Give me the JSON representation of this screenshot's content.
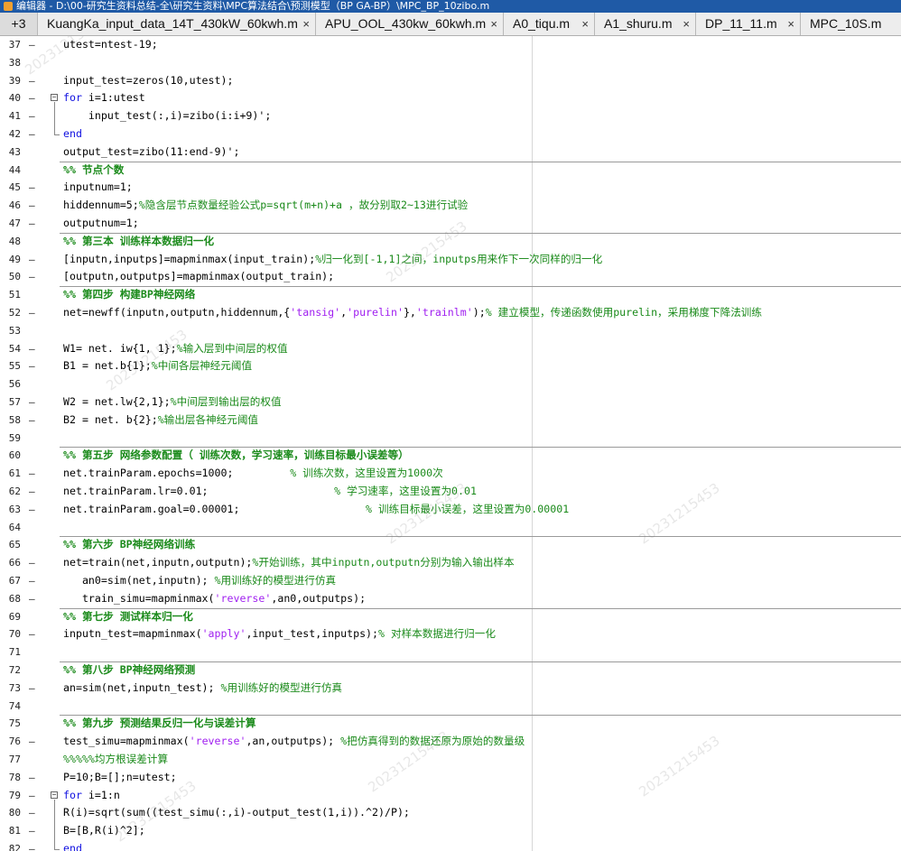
{
  "window": {
    "title": "编辑器 - D:\\00-研究生资料总结-全\\研究生资料\\MPC算法结合\\预测模型（BP GA-BP）\\MPC_BP_10zibo.m"
  },
  "tabs": {
    "overflow_count": "+3",
    "items": [
      {
        "label": "KuangKa_input_data_14T_430kW_60kwh.m",
        "close": "×"
      },
      {
        "label": "APU_OOL_430kw_60kwh.m",
        "close": "×"
      },
      {
        "label": "A0_tiqu.m",
        "close": "×"
      },
      {
        "label": "A1_shuru.m",
        "close": "×"
      },
      {
        "label": "DP_11_11.m",
        "close": "×"
      },
      {
        "label": "MPC_10S.m",
        "close": ""
      }
    ]
  },
  "watermark": "20231215453",
  "lines": [
    {
      "n": "37",
      "dash": "–",
      "segments": [
        {
          "t": "utest=ntest-19;"
        }
      ]
    },
    {
      "n": "38",
      "dash": "",
      "segments": []
    },
    {
      "n": "39",
      "dash": "–",
      "segments": [
        {
          "t": "input_test=zeros(10,utest);"
        }
      ]
    },
    {
      "n": "40",
      "dash": "–",
      "fold": "−",
      "segments": [
        {
          "t": "for",
          "k": "k"
        },
        {
          "t": " i=1:utest"
        }
      ]
    },
    {
      "n": "41",
      "dash": "–",
      "segments": [
        {
          "t": "    input_test(:,i)=zibo(i:i+9)';"
        }
      ]
    },
    {
      "n": "42",
      "dash": "–",
      "segments": [
        {
          "t": "end",
          "k": "k"
        }
      ]
    },
    {
      "n": "43",
      "dash": "",
      "segments": [
        {
          "t": "output_test=zibo(11:end-9)';"
        }
      ]
    },
    {
      "n": "44",
      "dash": "",
      "cell": true,
      "segments": [
        {
          "t": "%% 节点个数",
          "k": "c"
        }
      ]
    },
    {
      "n": "45",
      "dash": "–",
      "segments": [
        {
          "t": "inputnum=1;"
        }
      ]
    },
    {
      "n": "46",
      "dash": "–",
      "segments": [
        {
          "t": "hiddennum=5;"
        },
        {
          "t": "%隐含层节点数量经验公式p=sqrt(m+n)+a ，故分别取2~13进行试验",
          "k": "c"
        }
      ]
    },
    {
      "n": "47",
      "dash": "–",
      "segments": [
        {
          "t": "outputnum=1;"
        }
      ]
    },
    {
      "n": "48",
      "dash": "",
      "cell": true,
      "segments": [
        {
          "t": "%% 第三本 训练样本数据归一化",
          "k": "c"
        }
      ]
    },
    {
      "n": "49",
      "dash": "–",
      "segments": [
        {
          "t": "[inputn,inputps]=mapminmax(input_train);"
        },
        {
          "t": "%归一化到[-1,1]之间，inputps用来作下一次同样的归一化",
          "k": "c"
        }
      ]
    },
    {
      "n": "50",
      "dash": "–",
      "segments": [
        {
          "t": "[outputn,outputps]=mapminmax(output_train);"
        }
      ]
    },
    {
      "n": "51",
      "dash": "",
      "cell": true,
      "segments": [
        {
          "t": "%% 第四步 构建BP神经网络",
          "k": "c"
        }
      ]
    },
    {
      "n": "52",
      "dash": "–",
      "segments": [
        {
          "t": "net=newff(inputn,outputn,hiddennum,{"
        },
        {
          "t": "'tansig'",
          "k": "s"
        },
        {
          "t": ","
        },
        {
          "t": "'purelin'",
          "k": "s"
        },
        {
          "t": "},"
        },
        {
          "t": "'trainlm'",
          "k": "s"
        },
        {
          "t": ");"
        },
        {
          "t": "% 建立模型，传递函数使用purelin，采用梯度下降法训练",
          "k": "c"
        }
      ]
    },
    {
      "n": "53",
      "dash": "",
      "segments": []
    },
    {
      "n": "54",
      "dash": "–",
      "segments": [
        {
          "t": "W1= net. iw{1, 1};"
        },
        {
          "t": "%输入层到中间层的权值",
          "k": "c"
        }
      ]
    },
    {
      "n": "55",
      "dash": "–",
      "segments": [
        {
          "t": "B1 = net.b{1};"
        },
        {
          "t": "%中间各层神经元阈值",
          "k": "c"
        }
      ]
    },
    {
      "n": "56",
      "dash": "",
      "segments": []
    },
    {
      "n": "57",
      "dash": "–",
      "segments": [
        {
          "t": "W2 = net.lw{2,1};"
        },
        {
          "t": "%中间层到输出层的权值",
          "k": "c"
        }
      ]
    },
    {
      "n": "58",
      "dash": "–",
      "segments": [
        {
          "t": "B2 = net. b{2};"
        },
        {
          "t": "%输出层各神经元阈值",
          "k": "c"
        }
      ]
    },
    {
      "n": "59",
      "dash": "",
      "segments": []
    },
    {
      "n": "60",
      "dash": "",
      "cell": true,
      "segments": [
        {
          "t": "%% 第五步 网络参数配置（ 训练次数，学习速率，训练目标最小误差等）",
          "k": "c"
        }
      ]
    },
    {
      "n": "61",
      "dash": "–",
      "segments": [
        {
          "t": "net.trainParam.epochs=1000;         "
        },
        {
          "t": "% 训练次数，这里设置为1000次",
          "k": "c"
        }
      ]
    },
    {
      "n": "62",
      "dash": "–",
      "segments": [
        {
          "t": "net.trainParam.lr=0.01;                    "
        },
        {
          "t": "% 学习速率，这里设置为0.01",
          "k": "c"
        }
      ]
    },
    {
      "n": "63",
      "dash": "–",
      "segments": [
        {
          "t": "net.trainParam.goal=0.00001;                    "
        },
        {
          "t": "% 训练目标最小误差，这里设置为0.00001",
          "k": "c"
        }
      ]
    },
    {
      "n": "64",
      "dash": "",
      "segments": []
    },
    {
      "n": "65",
      "dash": "",
      "cell": true,
      "segments": [
        {
          "t": "%% 第六步 BP神经网络训练",
          "k": "c"
        }
      ]
    },
    {
      "n": "66",
      "dash": "–",
      "segments": [
        {
          "t": "net=train(net,inputn,outputn);"
        },
        {
          "t": "%开始训练，其中inputn,outputn分别为输入输出样本",
          "k": "c"
        }
      ]
    },
    {
      "n": "67",
      "dash": "–",
      "segments": [
        {
          "t": "   an0=sim(net,inputn); "
        },
        {
          "t": "%用训练好的模型进行仿真",
          "k": "c"
        }
      ]
    },
    {
      "n": "68",
      "dash": "–",
      "segments": [
        {
          "t": "   train_simu=mapminmax("
        },
        {
          "t": "'reverse'",
          "k": "s"
        },
        {
          "t": ",an0,outputps);"
        }
      ]
    },
    {
      "n": "69",
      "dash": "",
      "cell": true,
      "segments": [
        {
          "t": "%% 第七步 测试样本归一化",
          "k": "c"
        }
      ]
    },
    {
      "n": "70",
      "dash": "–",
      "segments": [
        {
          "t": "inputn_test=mapminmax("
        },
        {
          "t": "'apply'",
          "k": "s"
        },
        {
          "t": ",input_test,inputps);"
        },
        {
          "t": "% 对样本数据进行归一化",
          "k": "c"
        }
      ]
    },
    {
      "n": "71",
      "dash": "",
      "segments": []
    },
    {
      "n": "72",
      "dash": "",
      "cell": true,
      "segments": [
        {
          "t": "%% 第八步 BP神经网络预测",
          "k": "c"
        }
      ]
    },
    {
      "n": "73",
      "dash": "–",
      "segments": [
        {
          "t": "an=sim(net,inputn_test); "
        },
        {
          "t": "%用训练好的模型进行仿真",
          "k": "c"
        }
      ]
    },
    {
      "n": "74",
      "dash": "",
      "segments": []
    },
    {
      "n": "75",
      "dash": "",
      "cell": true,
      "segments": [
        {
          "t": "%% 第九步 预测结果反归一化与误差计算",
          "k": "c"
        }
      ]
    },
    {
      "n": "76",
      "dash": "–",
      "segments": [
        {
          "t": "test_simu=mapminmax("
        },
        {
          "t": "'reverse'",
          "k": "s"
        },
        {
          "t": ",an,outputps); "
        },
        {
          "t": "%把仿真得到的数据还原为原始的数量级",
          "k": "c"
        }
      ]
    },
    {
      "n": "77",
      "dash": "",
      "segments": [
        {
          "t": "%%%%%均方根误差计算",
          "k": "c"
        }
      ]
    },
    {
      "n": "78",
      "dash": "–",
      "segments": [
        {
          "t": "P=10;B=[];n=utest;"
        }
      ]
    },
    {
      "n": "79",
      "dash": "–",
      "fold": "−",
      "segments": [
        {
          "t": "for",
          "k": "k"
        },
        {
          "t": " i=1:n"
        }
      ]
    },
    {
      "n": "80",
      "dash": "–",
      "segments": [
        {
          "t": "R(i)=sqrt(sum((test_simu(:,i)-output_test(1,i)).^2)/P);"
        }
      ]
    },
    {
      "n": "81",
      "dash": "–",
      "segments": [
        {
          "t": "B=[B,R(i)^2];"
        }
      ]
    },
    {
      "n": "82",
      "dash": "–",
      "segments": [
        {
          "t": "end",
          "k": "k"
        }
      ]
    }
  ]
}
